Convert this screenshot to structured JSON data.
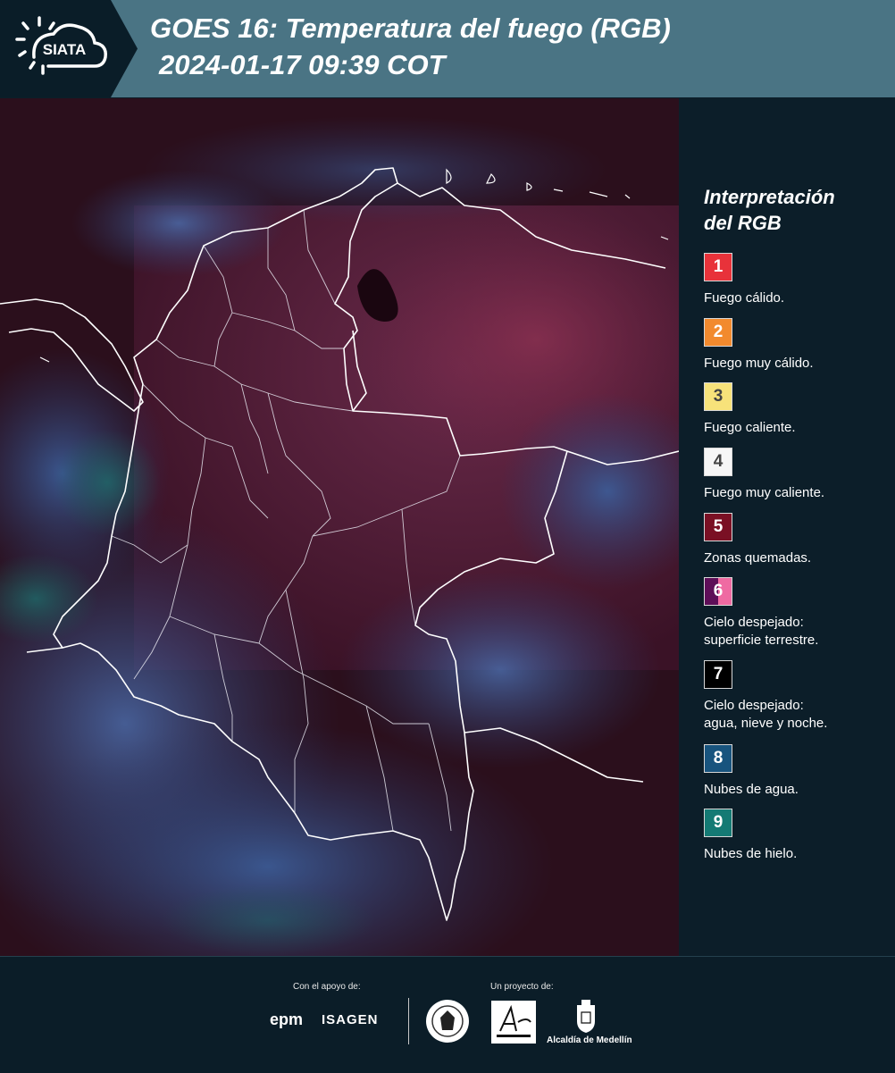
{
  "header": {
    "logo_text": "SIATA",
    "title_line1": "GOES 16: Temperatura del fuego (RGB)",
    "title_line2": "2024-01-17 09:39 COT"
  },
  "legend": {
    "title_line1": "Interpretación",
    "title_line2": "del RGB",
    "items": [
      {
        "number": "1",
        "label": "Fuego cálido.",
        "color": "#e8323a",
        "text_color": "#ffffff"
      },
      {
        "number": "2",
        "label": "Fuego muy cálido.",
        "color": "#f28a2e",
        "text_color": "#ffffff"
      },
      {
        "number": "3",
        "label": "Fuego caliente.",
        "color": "#f7e27a",
        "text_color": "#444444"
      },
      {
        "number": "4",
        "label": "Fuego muy caliente.",
        "color": "#f6f6f6",
        "text_color": "#444444"
      },
      {
        "number": "5",
        "label": "Zonas quemadas.",
        "color": "#7a1024",
        "text_color": "#ffffff"
      },
      {
        "number": "6",
        "label_line1": "Cielo despejado:",
        "label_line2": "superficie terrestre.",
        "color": "#5e0e58",
        "color2": "#ef6aa2",
        "text_color": "#ffffff"
      },
      {
        "number": "7",
        "label_line1": "Cielo despejado:",
        "label_line2": "agua, nieve y noche.",
        "color": "#000000",
        "text_color": "#ffffff"
      },
      {
        "number": "8",
        "label": "Nubes de agua.",
        "color": "#18547e",
        "text_color": "#ffffff"
      },
      {
        "number": "9",
        "label": "Nubes de hielo.",
        "color": "#147a74",
        "text_color": "#ffffff"
      }
    ]
  },
  "footer": {
    "support_label": "Con el apoyo de:",
    "project_label": "Un proyecto de:",
    "sponsor1": "epm",
    "sponsor2": "ISAGEN",
    "alcaldia": "Alcaldía de Medellín"
  }
}
